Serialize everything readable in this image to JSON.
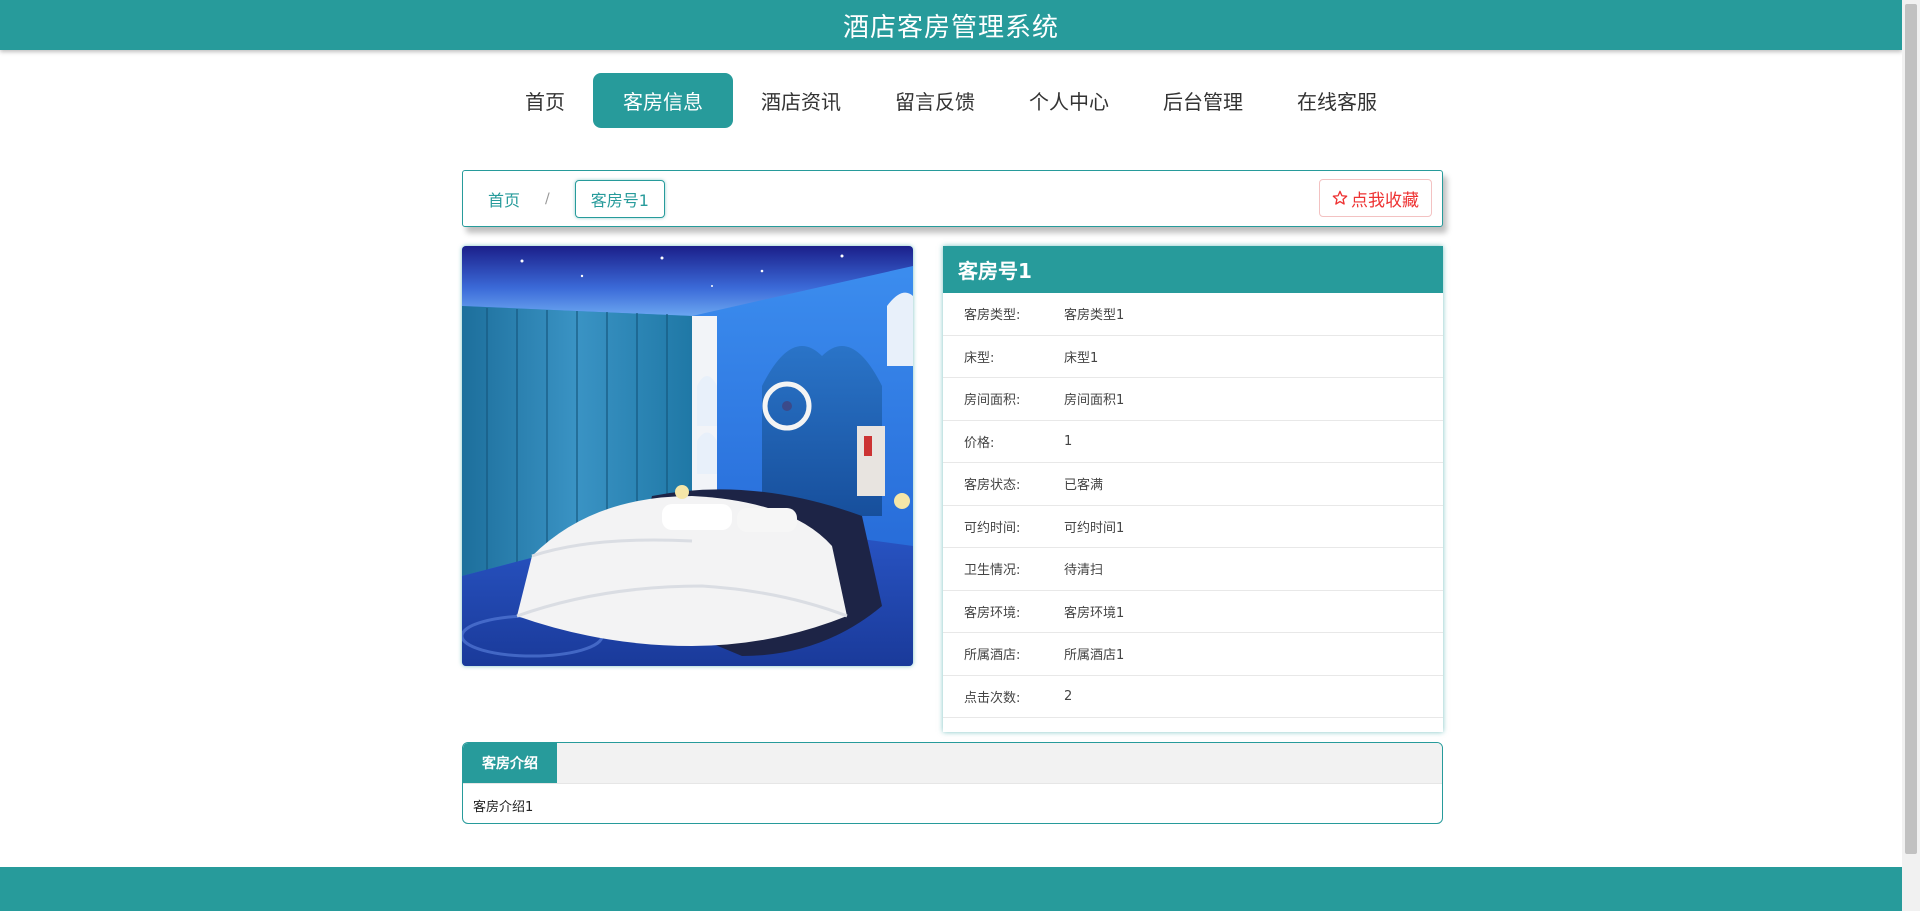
{
  "header": {
    "title": "酒店客房管理系统"
  },
  "nav": {
    "items": [
      {
        "label": "首页"
      },
      {
        "label": "客房信息"
      },
      {
        "label": "酒店资讯"
      },
      {
        "label": "留言反馈"
      },
      {
        "label": "个人中心"
      },
      {
        "label": "后台管理"
      },
      {
        "label": "在线客服"
      }
    ],
    "active": "客房信息"
  },
  "breadcrumb": {
    "home": "首页",
    "separator": "/",
    "current": "客房号1"
  },
  "favorite": {
    "label": "点我收藏",
    "icon": "star-outline-icon"
  },
  "room": {
    "title": "客房号1",
    "fields": [
      {
        "label": "客房类型:",
        "value": "客房类型1"
      },
      {
        "label": "床型:",
        "value": "床型1"
      },
      {
        "label": "房间面积:",
        "value": "房间面积1"
      },
      {
        "label": "价格:",
        "value": "1"
      },
      {
        "label": "客房状态:",
        "value": "已客满"
      },
      {
        "label": "可约时间:",
        "value": "可约时间1"
      },
      {
        "label": "卫生情况:",
        "value": "待清扫"
      },
      {
        "label": "客房环境:",
        "value": "客房环境1"
      },
      {
        "label": "所属酒店:",
        "value": "所属酒店1"
      },
      {
        "label": "点击次数:",
        "value": "2"
      }
    ]
  },
  "intro": {
    "tab_label": "客房介绍",
    "content": "客房介绍1"
  },
  "colors": {
    "accent": "#279b9b",
    "favorite": "#ee3333"
  }
}
